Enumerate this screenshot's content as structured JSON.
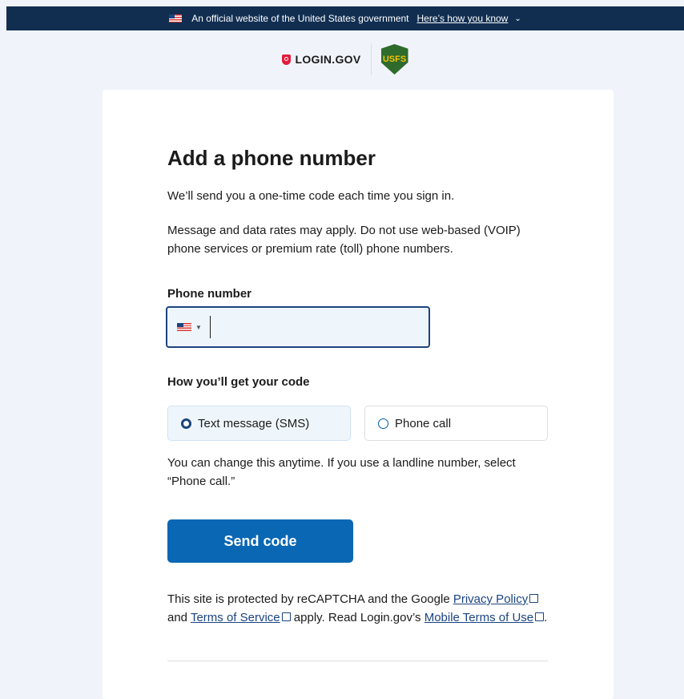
{
  "banner": {
    "text": "An official website of the United States government",
    "link": "Here’s how you know",
    "chevron_icon": "chevron-down-icon"
  },
  "header": {
    "login_logo": "LOGIN.GOV",
    "partner_logo": "USFS"
  },
  "page": {
    "title": "Add a phone number",
    "intro": "We’ll send you a one-time code each time you sign in.",
    "rates_note": "Message and data rates may apply. Do not use web-based (VOIP) phone services or premium rate (toll) phone numbers."
  },
  "phone": {
    "label": "Phone number",
    "country_flag_icon": "us-flag-icon",
    "value": ""
  },
  "delivery": {
    "label": "How you’ll get your code",
    "options": [
      {
        "label": "Text message (SMS)",
        "selected": true
      },
      {
        "label": "Phone call",
        "selected": false
      }
    ],
    "help": "You can change this anytime. If you use a landline number, select “Phone call.”"
  },
  "actions": {
    "send_label": "Send code"
  },
  "recaptcha": {
    "text1": "This site is protected by reCAPTCHA and the Google ",
    "privacy_link": "Privacy Policy",
    "text2": " and ",
    "terms_link": "Terms of Service",
    "text3": " apply. Read Login.gov’s ",
    "mobile_link": "Mobile Terms of Use",
    "text4": "."
  },
  "colors": {
    "banner_bg": "#112e51",
    "primary_button": "#0a67b4",
    "page_bg": "#f0f4fa",
    "focus_border": "#1a4480"
  }
}
